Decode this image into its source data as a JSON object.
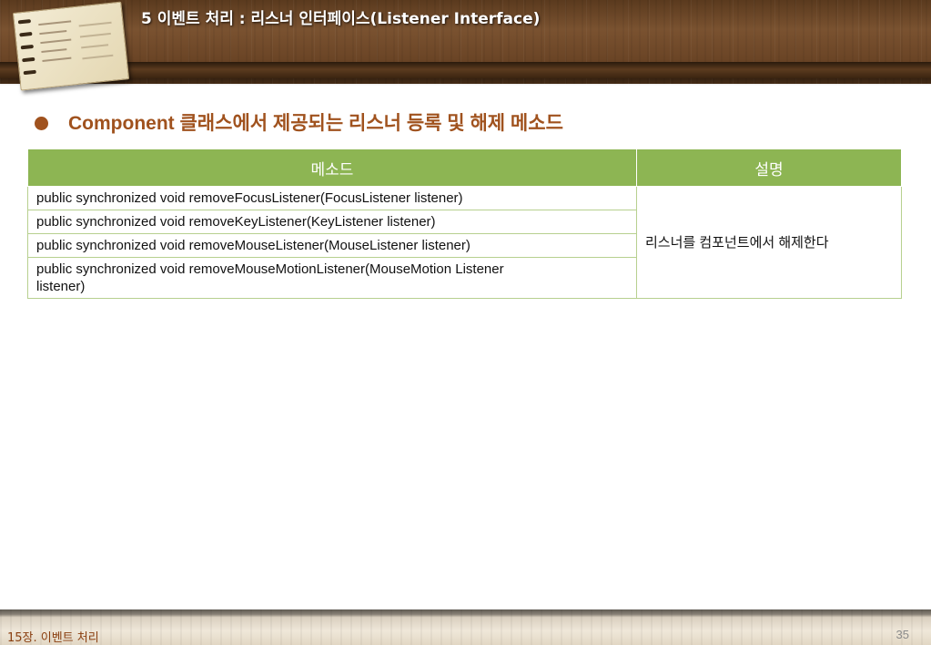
{
  "header": {
    "title": "5 이벤트 처리 : 리스너 인터페이스(Listener Interface)"
  },
  "heading": {
    "text": "Component 클래스에서 제공되는 리스너 등록 및 해제 메소드"
  },
  "table": {
    "columns": [
      "메소드",
      "설명"
    ],
    "rows": [
      "public  synchronized  void  removeFocusListener(FocusListener listener)",
      "public synchronized void removeKeyListener(KeyListener listener)",
      "public  synchronized  void  removeMouseListener(MouseListener listener)",
      "public synchronized void removeMouseMotionListener(MouseMotion Listener listener)"
    ],
    "description": "리스너를 컴포넌트에서 해제한다"
  },
  "footer": {
    "chapter": "15장. 이벤트 처리",
    "page": "35"
  }
}
